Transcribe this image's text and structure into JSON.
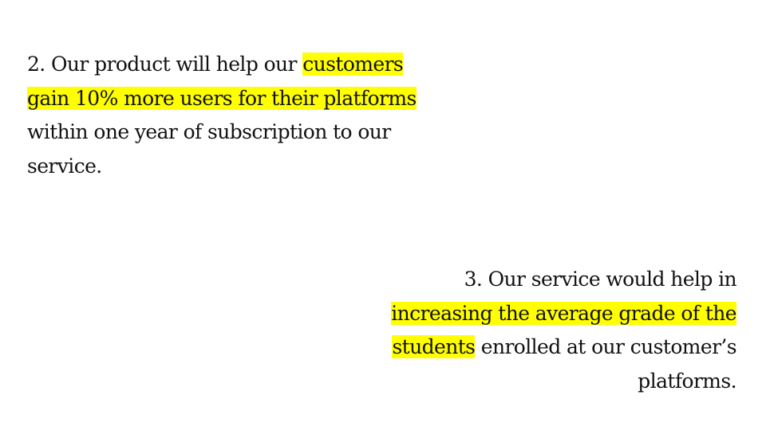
{
  "point_2": {
    "lines": [
      {
        "plain": "2. Our product will help our ",
        "highlight": "customers"
      },
      {
        "highlight": "gain 10% more users for their platforms"
      },
      {
        "plain": "within one year of subscription to our"
      },
      {
        "plain": "service."
      }
    ]
  },
  "point_3": {
    "lines": [
      {
        "plain": "3. Our service would help in"
      },
      {
        "highlight": "increasing the average grade of the"
      },
      {
        "highlight": "students",
        "plain_after": " enrolled at our customer’s"
      },
      {
        "plain": "platforms."
      }
    ]
  },
  "colors": {
    "highlight": "#ffff00",
    "text": "#111111",
    "background": "#ffffff"
  }
}
